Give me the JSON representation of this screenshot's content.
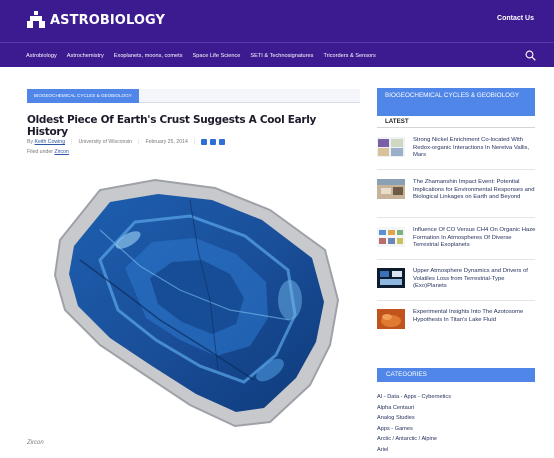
{
  "header": {
    "logo_text": "ASTROBIOLOGY",
    "contact_label": "Contact Us",
    "brand_color": "#3c1a8f"
  },
  "nav": {
    "items": [
      "Astrobiology",
      "Astrochemistry",
      "Exoplanets, moons, comets",
      "Space Life Science",
      "SETI & Technosignatures",
      "Tricorders & Sensors"
    ],
    "search_icon": "search-icon"
  },
  "article": {
    "category": "BIOGEOCHEMICAL CYCLES & GEOBIOLOGY",
    "title": "Oldest Piece Of Earth's Crust Suggests A Cool Early History",
    "by_label": "By",
    "author": "Keith Cowing",
    "source": "University of Wisconsin",
    "date": "February 25, 2014",
    "filed_label": "Filed under",
    "filed_tag": "Zircon",
    "share_icons": [
      "linkedin-icon",
      "facebook-icon",
      "twitter-icon"
    ],
    "caption": "Zircon"
  },
  "sidebar": {
    "category_title": "BIOGEOCHEMICAL CYCLES & GEOBIOLOGY",
    "latest_label": "LATEST",
    "news": [
      {
        "headline": "Strong Nickel Enrichment Co-located With Redox-organic Interactions In Neretva Vallis, Mars"
      },
      {
        "headline": "The Zhamanshin Impact Event: Potential Implications for Environmental Responses and Biological Linkages on Earth and Beyond"
      },
      {
        "headline": "Influence Of CO Versus CH4 On Organic Haze Formation In Atmospheres Of Diverse Terrestrial Exoplanets"
      },
      {
        "headline": "Upper Atmosphere Dynamics and Drivers of Volatiles Loss from Terrestrial-Type (Exo)Planets"
      },
      {
        "headline": "Experimental Insights Into The Azotosome Hypothesis In Titan's Lake Fluid"
      }
    ],
    "categories_label": "CATEGORIES",
    "categories": [
      "AI - Data - Apps - Cybernetics",
      "Alpha Centauri",
      "Analog Studies",
      "Apps - Games",
      "Arctic / Antarctic / Alpine",
      "Ariel"
    ]
  }
}
